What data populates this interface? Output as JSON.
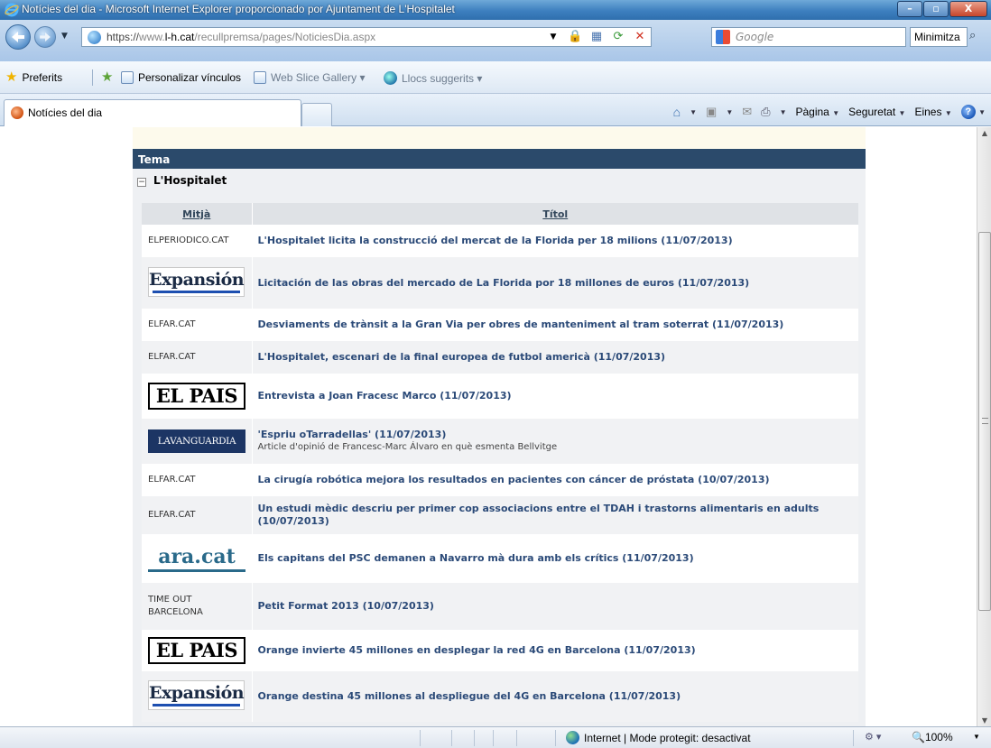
{
  "window": {
    "title": "Notícies del dia - Microsoft Internet Explorer proporcionado por Ajuntament de L'Hospitalet",
    "buttons": {
      "minimize": "–",
      "maximize": "▫",
      "close": "X"
    }
  },
  "address_bar": {
    "scheme": "https://",
    "host_prefix": "www.",
    "host": "l-h.cat",
    "path": "/recullpremsa/pages/NoticiesDia.aspx",
    "search_placeholder": "Google",
    "minimize_text": "Minimitza"
  },
  "favorites_bar": {
    "favorites_label": "Preferits",
    "items": [
      "Personalizar vínculos",
      "Web Slice Gallery ▾",
      "Llocs suggerits ▾"
    ]
  },
  "tabs": {
    "active_label": "Notícies del dia"
  },
  "command_bar": {
    "page": "Pàgina",
    "security": "Seguretat",
    "tools": "Eines",
    "help": "?"
  },
  "panel": {
    "header": "Tema",
    "group": "L'Hospitalet",
    "toggle": "−",
    "col_source": "Mitjà",
    "col_title": "Títol"
  },
  "news": [
    {
      "source_type": "text",
      "source": "ELPERIODICO.CAT",
      "title": "L'Hospitalet licita la construcció del mercat de la Florida per 18 milions (11/07/2013)"
    },
    {
      "source_type": "expansion",
      "source": "Expansión",
      "title": "Licitación de las obras del mercado de La Florida por 18 millones de euros (11/07/2013)"
    },
    {
      "source_type": "text",
      "source": "ELFAR.CAT",
      "title": "Desviaments de trànsit a la Gran Via per obres de manteniment al tram soterrat (11/07/2013)"
    },
    {
      "source_type": "text",
      "source": "ELFAR.CAT",
      "title": "L'Hospitalet, escenari de la final europea de futbol americà (11/07/2013)"
    },
    {
      "source_type": "elpais",
      "source": "EL PAIS",
      "title": "Entrevista a Joan Fracesc Marco (11/07/2013)"
    },
    {
      "source_type": "lavanguardia",
      "source": "LAVANGUARDIA",
      "title": "'Espriu oTarradellas' (11/07/2013)",
      "subtitle": "Article d'opinió de Francesc-Marc Álvaro en què esmenta Bellvitge"
    },
    {
      "source_type": "text",
      "source": "ELFAR.CAT",
      "title": "La cirugía robótica mejora los resultados en pacientes con cáncer de próstata (10/07/2013)"
    },
    {
      "source_type": "text",
      "source": "ELFAR.CAT",
      "title": "Un estudi mèdic descriu per primer cop associacions entre el TDAH i trastorns alimentaris en adults (10/07/2013)"
    },
    {
      "source_type": "ara",
      "source": "ara.cat",
      "title": "Els capitans del PSC demanen a Navarro mà dura amb els crítics (11/07/2013)"
    },
    {
      "source_type": "text",
      "source": "TIME OUT BARCELONA",
      "title": "Petit Format 2013 (10/07/2013)"
    },
    {
      "source_type": "elpais",
      "source": "EL PAIS",
      "title": "Orange invierte 45 millones en desplegar la red 4G en Barcelona (11/07/2013)"
    },
    {
      "source_type": "expansion",
      "source": "Expansión",
      "title": "Orange destina 45 millones al despliegue del 4G en Barcelona (11/07/2013)"
    }
  ],
  "status_bar": {
    "zone": "Internet | Mode protegit: desactivat",
    "zoom": "100%"
  },
  "colors": {
    "panel_header": "#2b4a6b",
    "link": "#2b4a78",
    "panel_bg": "#eef0f3"
  }
}
